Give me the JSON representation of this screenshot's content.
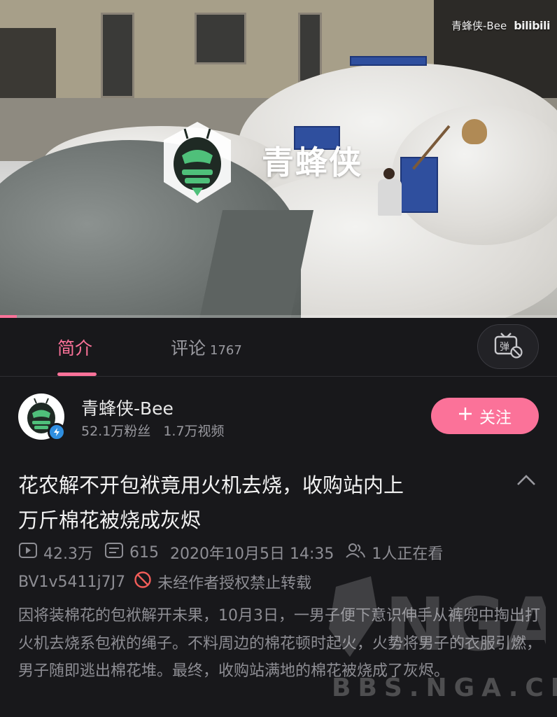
{
  "video": {
    "watermark_text": "青蜂侠",
    "corner_channel": "青蜂侠-Bee",
    "corner_brand": "bilibili",
    "progress": 0.03
  },
  "tabs": [
    {
      "label": "简介",
      "active": true
    },
    {
      "label": "评论",
      "count": "1767",
      "active": false
    }
  ],
  "danmaku_button_icon": "danmaku-off-icon",
  "uploader": {
    "name": "青蜂侠-Bee",
    "fans": "52.1万粉丝",
    "videos": "1.7万视频",
    "follow_label": "关注",
    "verified": true
  },
  "video_info": {
    "title_line1": "花农解不开包袱竟用火机去烧，收购站内上",
    "title_line2": "万斤棉花被烧成灰烬",
    "views": "42.3万",
    "danmaku": "615",
    "date": "2020年10月5日 14:35",
    "watching": "1人正在看",
    "bvid": "BV1v5411j7J7",
    "repost_notice": "未经作者授权禁止转载",
    "description": "因将装棉花的包袱解开未果，10月3日，一男子便下意识伸手从裤兜中掏出打火机去烧系包袱的绳子。不料周边的棉花顿时起火，火势将男子的衣服引燃，男子随即逃出棉花堆。最终，收购站满地的棉花被烧成了灰烬。"
  },
  "overlay_watermark": {
    "site": "BBS.NGA.CN"
  },
  "colors": {
    "accent": "#fb7299",
    "background": "#18181b",
    "verify": "#2f8fe0"
  }
}
